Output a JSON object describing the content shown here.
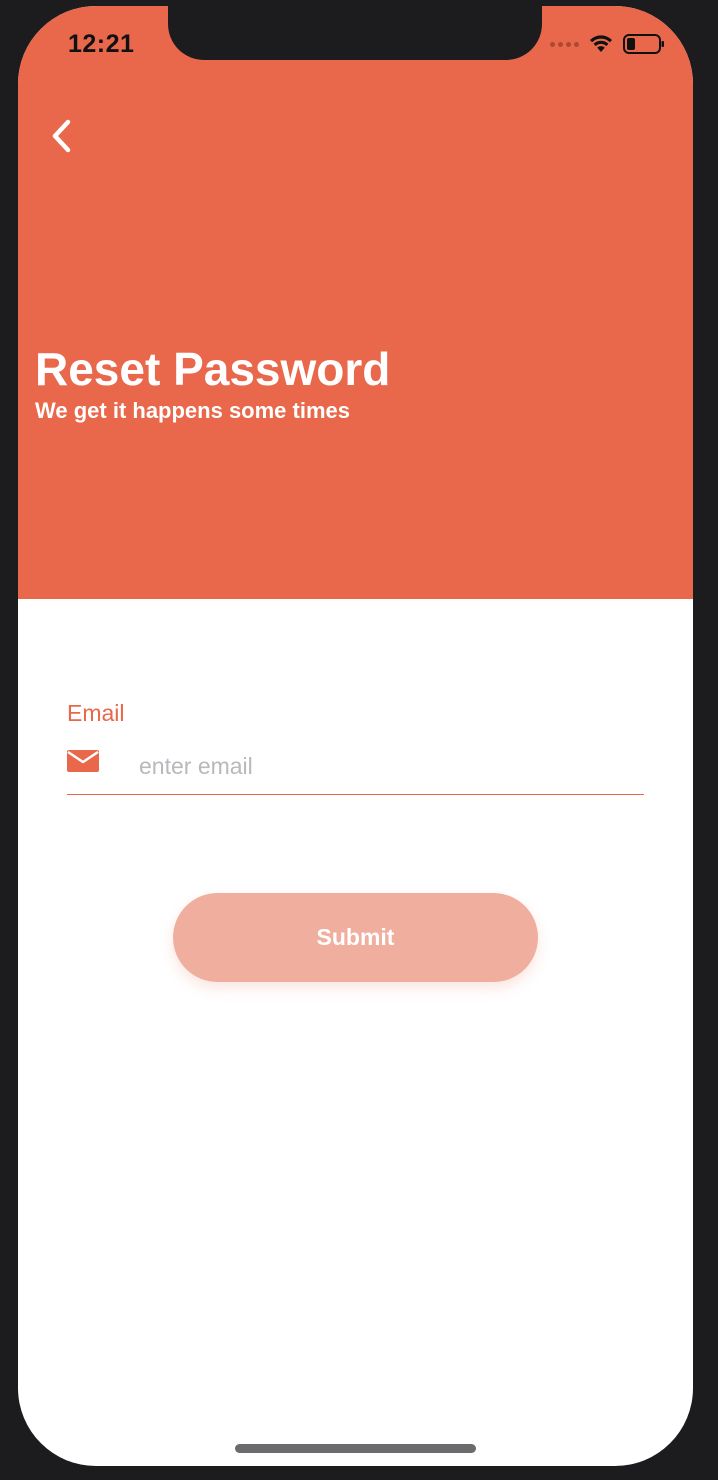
{
  "status_bar": {
    "time": "12:21"
  },
  "header": {
    "back_icon": "chevron-left-icon",
    "title": "Reset Password",
    "subtitle": "We get it happens some times"
  },
  "form": {
    "email_label": "Email",
    "email_icon": "mail-icon",
    "email_placeholder": "enter email",
    "email_value": "",
    "submit_label": "Submit"
  },
  "colors": {
    "accent": "#e9674b",
    "button_disabled": "#f0ae9f",
    "background": "#ffffff",
    "placeholder": "#b8b8bd"
  }
}
